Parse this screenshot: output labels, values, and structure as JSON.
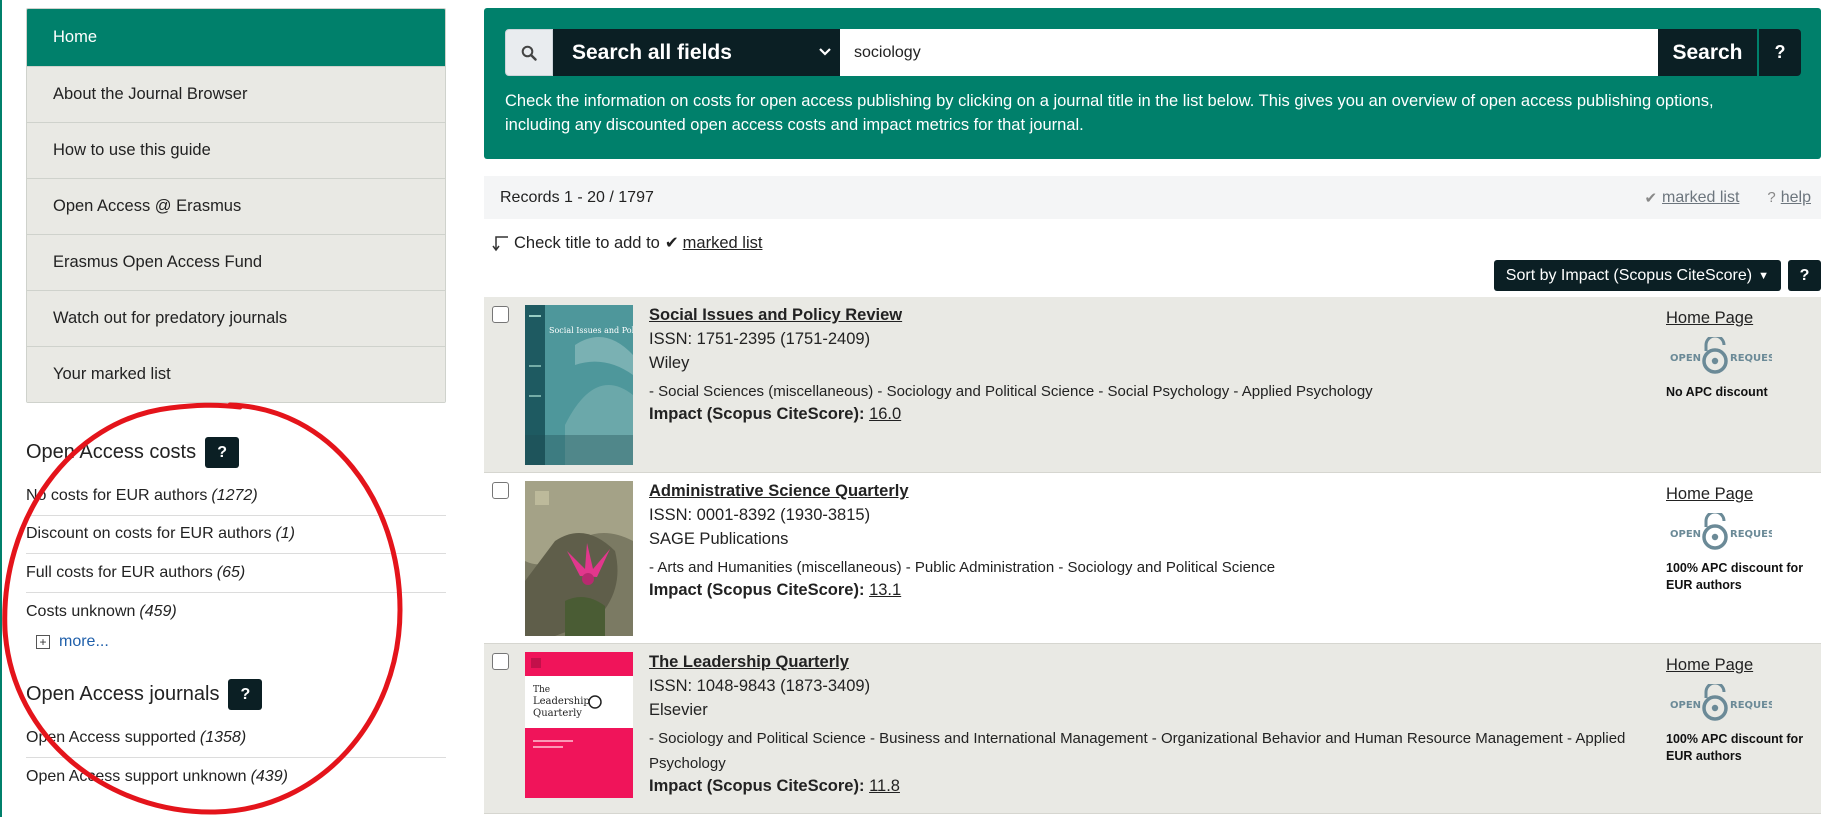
{
  "sidebar": {
    "nav": [
      {
        "label": "Home",
        "active": true
      },
      {
        "label": "About the Journal Browser"
      },
      {
        "label": "How to use this guide"
      },
      {
        "label": "Open Access @ Erasmus"
      },
      {
        "label": "Erasmus Open Access Fund"
      },
      {
        "label": "Watch out for predatory journals"
      },
      {
        "label": "Your marked list"
      }
    ],
    "costs": {
      "title": "Open Access costs",
      "help": "?",
      "items": [
        {
          "label": "No costs for EUR authors",
          "count": "(1272)"
        },
        {
          "label": "Discount on costs for EUR authors",
          "count": "(1)"
        },
        {
          "label": "Full costs for EUR authors",
          "count": "(65)"
        },
        {
          "label": "Costs unknown",
          "count": "(459)"
        }
      ],
      "more": "more..."
    },
    "journals": {
      "title": "Open Access journals",
      "help": "?",
      "items": [
        {
          "label": "Open Access supported",
          "count": "(1358)"
        },
        {
          "label": "Open Access support unknown",
          "count": "(439)"
        }
      ]
    }
  },
  "search": {
    "field": "Search all fields",
    "value": "sociology",
    "button": "Search",
    "help": "?",
    "description": "Check the information on costs for open access publishing by clicking on a journal title in the list below. This gives you an overview of open access publishing options, including any discounted open access costs and impact metrics for that journal."
  },
  "records": {
    "summary": "Records 1 - 20 / 1797",
    "marked_list": "marked list",
    "help": "help",
    "help_mark": "?"
  },
  "hint": {
    "text": "Check title to add to",
    "link": "marked list"
  },
  "sort": {
    "label": "Sort by Impact (Scopus CiteScore)",
    "help": "?"
  },
  "results": [
    {
      "title": "Social Issues and Policy Review",
      "issn": "ISSN: 1751-2395 (1751-2409)",
      "publisher": "Wiley",
      "subjects": "- Social Sciences (miscellaneous) - Sociology and Political Science - Social Psychology - Applied Psychology",
      "impact_label": "Impact (Scopus CiteScore):",
      "impact_value": "16.0",
      "home": "Home Page",
      "discount": "No APC discount"
    },
    {
      "title": "Administrative Science Quarterly",
      "issn": "ISSN: 0001-8392 (1930-3815)",
      "publisher": "SAGE Publications",
      "subjects": "- Arts and Humanities (miscellaneous) - Public Administration - Sociology and Political Science",
      "impact_label": "Impact (Scopus CiteScore):",
      "impact_value": "13.1",
      "home": "Home Page",
      "discount": "100% APC discount for EUR authors"
    },
    {
      "title": "The Leadership Quarterly",
      "issn": "ISSN: 1048-9843 (1873-3409)",
      "publisher": "Elsevier",
      "subjects": "- Sociology and Political Science - Business and International Management - Organizational Behavior and Human Resource Management - Applied Psychology",
      "impact_label": "Impact (Scopus CiteScore):",
      "impact_value": "11.8",
      "home": "Home Page",
      "discount": "100% APC discount for EUR authors"
    }
  ],
  "covers": {
    "c1_title": "Social Issues and Policy Review",
    "c3_title_1": "The",
    "c3_title_2": "Leadership",
    "c3_title_3": "Quarterly"
  },
  "oa_badge": {
    "left": "OPEN",
    "right": "REQUEST"
  },
  "colors": {
    "brand": "#00806b",
    "dark": "#0b1f24",
    "annotation": "#e4141b"
  }
}
